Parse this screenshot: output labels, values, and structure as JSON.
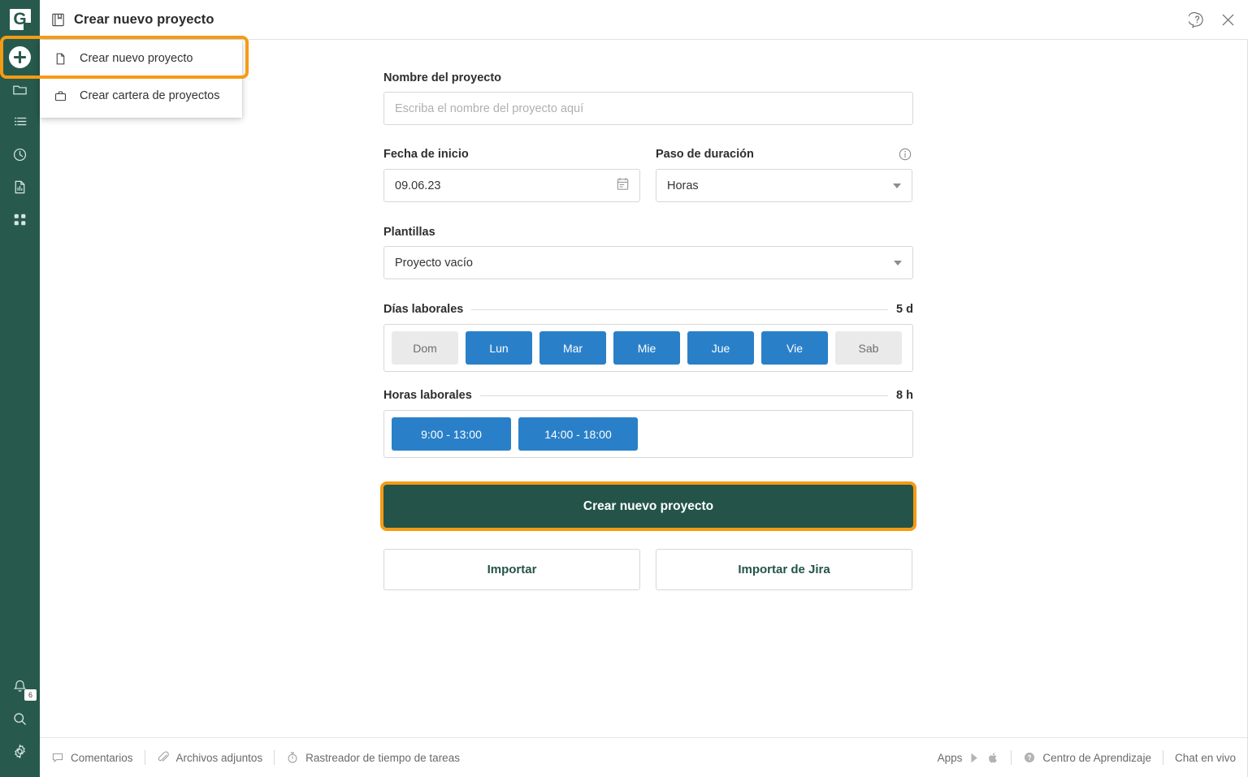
{
  "app": {
    "logo_letter": "G",
    "accent_green": "#275a4c",
    "button_green": "#245449",
    "highlight_orange": "#f59b14",
    "chip_blue": "#2a80c8"
  },
  "sidebar": {
    "items": [
      {
        "name": "create-new",
        "icon": "plus-circle-icon",
        "label": "Crear"
      },
      {
        "name": "projects",
        "icon": "folder-icon",
        "label": "Proyectos"
      },
      {
        "name": "list",
        "icon": "list-icon",
        "label": "Lista"
      },
      {
        "name": "history",
        "icon": "clock-icon",
        "label": "Historial"
      },
      {
        "name": "reports",
        "icon": "report-icon",
        "label": "Informes"
      },
      {
        "name": "apps-grid",
        "icon": "grid-icon",
        "label": "Aplicaciones"
      }
    ],
    "bottom_items": [
      {
        "name": "notifications",
        "icon": "bell-icon",
        "badge": "6",
        "label": "Notificaciones"
      },
      {
        "name": "search",
        "icon": "search-icon",
        "label": "Buscar"
      },
      {
        "name": "settings",
        "icon": "gear-icon",
        "label": "Configuración"
      }
    ]
  },
  "titlebar": {
    "icon": "book-icon",
    "title": "Crear nuevo proyecto",
    "help_icon": "help-bubble-icon",
    "close_icon": "close-icon"
  },
  "menu": {
    "items": [
      {
        "icon": "file-icon",
        "label": "Crear nuevo proyecto",
        "highlighted": true
      },
      {
        "icon": "briefcase-icon",
        "label": "Crear cartera de proyectos",
        "highlighted": false
      }
    ]
  },
  "form": {
    "project_name": {
      "label": "Nombre del proyecto",
      "value": "",
      "placeholder": "Escriba el nombre del proyecto aquí"
    },
    "start_date": {
      "label": "Fecha de inicio",
      "value": "09.06.23",
      "icon": "calendar-icon"
    },
    "duration_step": {
      "label": "Paso de duración",
      "value": "Horas",
      "info_icon": "info-icon",
      "options": [
        "Horas"
      ]
    },
    "templates": {
      "label": "Plantillas",
      "value": "Proyecto vacío",
      "options": [
        "Proyecto vacío"
      ]
    },
    "working_days": {
      "label": "Días laborales",
      "value": "5 d",
      "days": [
        {
          "label": "Dom",
          "selected": false
        },
        {
          "label": "Lun",
          "selected": true
        },
        {
          "label": "Mar",
          "selected": true
        },
        {
          "label": "Mie",
          "selected": true
        },
        {
          "label": "Jue",
          "selected": true
        },
        {
          "label": "Vie",
          "selected": true
        },
        {
          "label": "Sab",
          "selected": false
        }
      ]
    },
    "working_hours": {
      "label": "Horas laborales",
      "value": "8 h",
      "ranges": [
        {
          "label": "9:00 - 13:00",
          "selected": true
        },
        {
          "label": "14:00 - 18:00",
          "selected": true
        }
      ]
    },
    "primary_button": "Crear nuevo proyecto",
    "import_button": "Importar",
    "import_jira_button": "Importar de Jira"
  },
  "footer": {
    "left": [
      {
        "icon": "comment-icon",
        "label": "Comentarios"
      },
      {
        "icon": "attachment-icon",
        "label": "Archivos adjuntos"
      },
      {
        "icon": "stopwatch-icon",
        "label": "Rastreador de tiempo de tareas"
      }
    ],
    "right": {
      "apps_label": "Apps",
      "play_icon": "google-play-icon",
      "apple_icon": "apple-icon",
      "learning_icon": "help-circle-icon",
      "learning_label": "Centro de Aprendizaje",
      "chat_label": "Chat en vivo"
    }
  }
}
